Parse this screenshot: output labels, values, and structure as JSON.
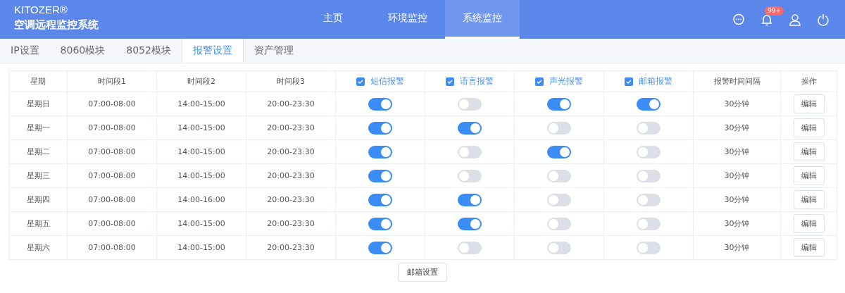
{
  "brand": {
    "name": "KITOZER®",
    "subtitle": "空调远程监控系统"
  },
  "nav": [
    {
      "label": "主页",
      "selected": false
    },
    {
      "label": "环境监控",
      "selected": false
    },
    {
      "label": "系统监控",
      "selected": true
    }
  ],
  "header_actions": [
    {
      "kind": "chat"
    },
    {
      "kind": "bell",
      "badge": "99+"
    },
    {
      "kind": "user"
    },
    {
      "kind": "power"
    }
  ],
  "tabs": [
    {
      "label": "IP设置",
      "selected": false
    },
    {
      "label": "8060模块",
      "selected": false
    },
    {
      "label": "8052模块",
      "selected": false
    },
    {
      "label": "报警设置",
      "selected": true
    },
    {
      "label": "资产管理",
      "selected": false
    }
  ],
  "table": {
    "columns": [
      {
        "label": "星期",
        "kind": "text"
      },
      {
        "label": "时间段1",
        "kind": "text"
      },
      {
        "label": "时间段2",
        "kind": "text"
      },
      {
        "label": "时间段3",
        "kind": "text"
      },
      {
        "label": "短信报警",
        "kind": "check",
        "checked": true
      },
      {
        "label": "语言报警",
        "kind": "check",
        "checked": true
      },
      {
        "label": "声光报警",
        "kind": "check",
        "checked": true
      },
      {
        "label": "邮箱报警",
        "kind": "check",
        "checked": true
      },
      {
        "label": "报警时间间隔",
        "kind": "text"
      },
      {
        "label": "操作",
        "kind": "text"
      }
    ],
    "rows": [
      {
        "day": "星期日",
        "period_1": "07:00-08:00",
        "period_2": "14:00-15:00",
        "period_3": "20:00-23:30",
        "alarms": [
          {
            "on": true
          },
          {
            "on": false
          },
          {
            "on": true
          },
          {
            "on": true
          }
        ],
        "interval": "30分钟",
        "action": "编辑"
      },
      {
        "day": "星期一",
        "period_1": "07:00-08:00",
        "period_2": "14:00-15:00",
        "period_3": "20:00-23:30",
        "alarms": [
          {
            "on": true
          },
          {
            "on": true
          },
          {
            "on": false
          },
          {
            "on": false
          }
        ],
        "interval": "30分钟",
        "action": "编辑"
      },
      {
        "day": "星期二",
        "period_1": "07:00-08:00",
        "period_2": "14:00-15:00",
        "period_3": "20:00-23:30",
        "alarms": [
          {
            "on": true
          },
          {
            "on": false
          },
          {
            "on": true
          },
          {
            "on": false
          }
        ],
        "interval": "30分钟",
        "action": "编辑"
      },
      {
        "day": "星期三",
        "period_1": "07:00-08:00",
        "period_2": "14:00-15:00",
        "period_3": "20:00-23:30",
        "alarms": [
          {
            "on": true
          },
          {
            "on": false
          },
          {
            "on": false
          },
          {
            "on": false
          }
        ],
        "interval": "30分钟",
        "action": "编辑"
      },
      {
        "day": "星期四",
        "period_1": "07:00-08:00",
        "period_2": "14:00-16:00",
        "period_3": "20:00-23:30",
        "alarms": [
          {
            "on": true
          },
          {
            "on": true
          },
          {
            "on": false
          },
          {
            "on": false
          }
        ],
        "interval": "30分钟",
        "action": "编辑"
      },
      {
        "day": "星期五",
        "period_1": "07:00-08:00",
        "period_2": "14:00-15:00",
        "period_3": "20:00-23:30",
        "alarms": [
          {
            "on": true
          },
          {
            "on": true
          },
          {
            "on": false
          },
          {
            "on": false
          }
        ],
        "interval": "30分钟",
        "action": "编辑"
      },
      {
        "day": "星期六",
        "period_1": "07:00-08:00",
        "period_2": "14:00-15:00",
        "period_3": "20:00-23:30",
        "alarms": [
          {
            "on": true
          },
          {
            "on": false
          },
          {
            "on": false
          },
          {
            "on": false
          }
        ],
        "interval": "30分钟",
        "action": "编辑"
      }
    ]
  },
  "footer_button": "邮箱设置"
}
